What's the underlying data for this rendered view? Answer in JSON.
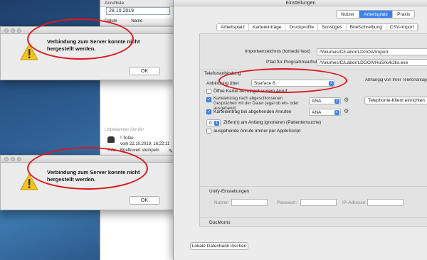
{
  "call_list": {
    "header": "Anrufliste",
    "date": "28.10.2019",
    "col_datum": "Datum",
    "col_name": "Name",
    "todo_label": "! ToDo",
    "todo_date": "vom 22.10.2019, 16:22:11",
    "todo_info_label": "Info:",
    "todo_info": "Briefkuvert stempeln",
    "partial_row": "Unbekannter Anrufer"
  },
  "dialog1": {
    "message": "Verbindung zum Server konnte nicht hergestellt werden.",
    "ok": "OK"
  },
  "dialog2": {
    "message": "Verbindung zum Server konnte nicht hergestellt werden.",
    "ok": "OK"
  },
  "prefs": {
    "title": "Einstellungen",
    "top_tabs": [
      {
        "label": "Nutzer",
        "active": false
      },
      {
        "label": "Arbeitsplatz",
        "active": true
      },
      {
        "label": "Praxis",
        "active": false
      }
    ],
    "sub_tabs": [
      "Arbeitsplatz",
      "Karteieinträge",
      "Druckprofile",
      "Sonstiges",
      "Briefschreibung",
      "CSV-Import"
    ],
    "import_label": "Importverzeichnis (tomedo liest)",
    "import_value": "/Volumes/C/Labor/LDGOA/Import",
    "program_label": "Pfad für Programmaufruf",
    "program_value": "/Volumes/C/Labor/LDGOA/HuS/kvk2lis.exe",
    "tel_section": "Telefonanbindung",
    "anbindung_label": "Anbindung über",
    "anbindung_value": "Starface 6",
    "open_card_label": "Öffne Kartei bei eingehendem Anruf",
    "entry_done_label": "Karteieintrag nach abgeschlossenen Gesprächen mit der Dauer (egal ob ein- oder ausgehend)",
    "entry_done_value": "ANA",
    "entry_rejected_label": "Karteieintrag bei abgehenden Anrufen",
    "entry_rejected_value": "ANA",
    "digits_value": "0",
    "digits_label": "Ziffer(n) am Anfang ignorieren (Patientensuche)",
    "applescript_label": "ausgehende Anrufe immer per AppleScript",
    "hint_text": "Abhängig von Ihrer Telefonanlage sind ggf. weitere Einstellungen im Telefonie-Klienten nötig; dazu finden Sie im tomedo-Handbuch oder direkt im Klienten weitere Informationen. Anruf-Panel (Tagesliste Menü -> Panel ein",
    "client_button": "Telephonie-Klient einrichten",
    "unify_section": "Unify-Einstellungen",
    "user_label": "Nutzer:",
    "password_label": "Passwort:",
    "ip_label": "IP-Adresse:",
    "docmorris_section": "DocMorris",
    "delete_db_button": "Lokale Datenbank löschen"
  },
  "colors": {
    "accent": "#3b82f0",
    "annotation": "#e0161c"
  }
}
